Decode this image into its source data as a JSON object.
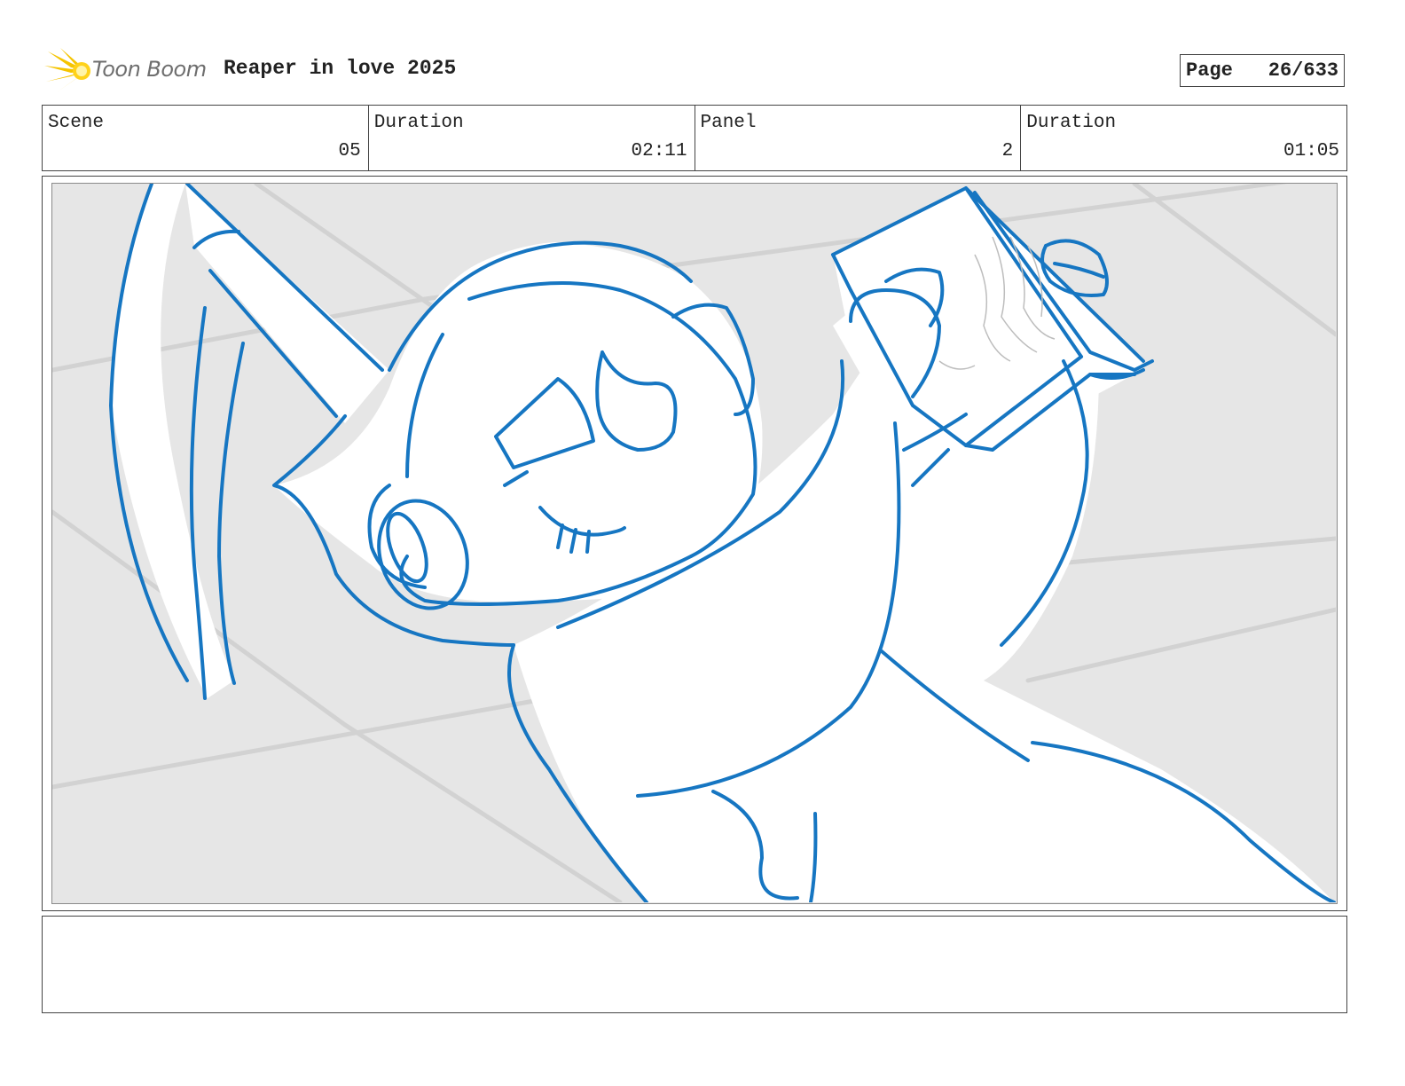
{
  "header": {
    "logo_text": "Toon Boom",
    "project_title": "Reaper in love 2025",
    "page_label": "Page",
    "page_value": "26/633"
  },
  "info": [
    {
      "label": "Scene",
      "value": "05"
    },
    {
      "label": "Duration",
      "value": "02:11"
    },
    {
      "label": "Panel",
      "value": "2"
    },
    {
      "label": "Duration",
      "value": "01:05"
    }
  ],
  "panel": {
    "line_color": "#1676c2",
    "background_color": "#e6e6e6"
  },
  "caption": {
    "text": ""
  }
}
